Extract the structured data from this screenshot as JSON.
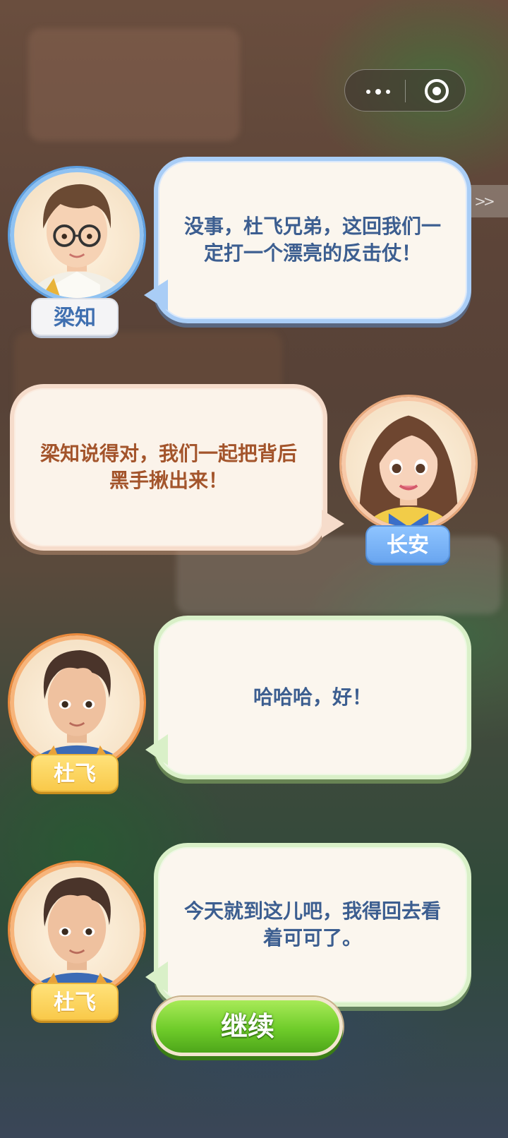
{
  "capsule": {
    "more_icon": "more-dots-icon",
    "close_icon": "target-close-icon"
  },
  "skip": {
    "label": ">>"
  },
  "dialogues": [
    {
      "speaker": "梁知",
      "text": "没事，杜飞兄弟，这回我们一定打一个漂亮的反击仗！",
      "side": "left",
      "bubble_color": "#a9cdf6",
      "tag_style": "white"
    },
    {
      "speaker": "长安",
      "text": "梁知说得对，我们一起把背后黑手揪出来！",
      "side": "right",
      "bubble_color": "#f6dccb",
      "tag_style": "blue"
    },
    {
      "speaker": "杜飞",
      "text": "哈哈哈，好！",
      "side": "left",
      "bubble_color": "#d9f0c8",
      "tag_style": "yellow"
    },
    {
      "speaker": "杜飞",
      "text": "今天就到这儿吧，我得回去看着可可了。",
      "side": "left",
      "bubble_color": "#d9f0c8",
      "tag_style": "yellow"
    }
  ],
  "continue_button": {
    "label": "继续",
    "color": "#6fcc2a"
  }
}
